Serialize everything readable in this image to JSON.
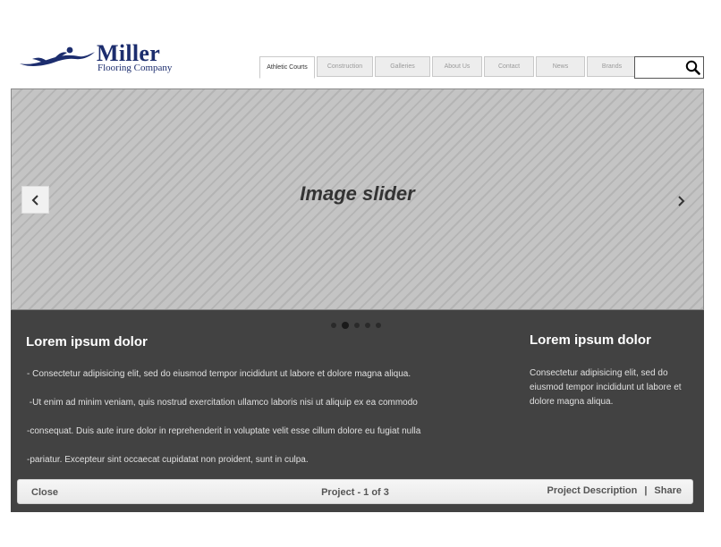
{
  "brand": {
    "name": "Miller",
    "subtitle": "Flooring Company",
    "color": "#1c2d6e"
  },
  "nav": {
    "tabs": [
      {
        "label": "Athletic Courts",
        "active": true
      },
      {
        "label": "Construction",
        "active": false
      },
      {
        "label": "Galleries",
        "active": false
      },
      {
        "label": "About Us",
        "active": false
      },
      {
        "label": "Contact",
        "active": false
      },
      {
        "label": "News",
        "active": false
      },
      {
        "label": "Brands",
        "active": false
      }
    ]
  },
  "search": {
    "icon": "search-icon",
    "placeholder": ""
  },
  "slider": {
    "title": "Image slider",
    "prev_icon": "chevron-left-icon",
    "next_icon": "chevron-right-icon",
    "total_slides": 5,
    "active_slide": 2
  },
  "details": {
    "left_heading": "Lorem ipsum dolor",
    "paragraphs": [
      "- Consectetur adipisicing elit, sed do eiusmod tempor incididunt ut labore et dolore magna aliqua.",
      " -Ut enim ad minim veniam, quis nostrud exercitation ullamco laboris nisi ut aliquip ex ea commodo",
      "-consequat. Duis aute irure dolor in reprehenderit in voluptate velit esse cillum dolore eu fugiat nulla",
      "-pariatur. Excepteur sint occaecat cupidatat non proident, sunt in culpa."
    ],
    "right_heading": "Lorem ipsum dolor",
    "right_text": "Consectetur adipisicing elit, sed do eiusmod tempor incididunt ut labore et dolore magna aliqua."
  },
  "footer": {
    "close_label": "Close",
    "counter": "Project - 1 of 3",
    "description_label": "Project Description",
    "separator": "|",
    "share_label": "Share"
  },
  "colors": {
    "panel_bg": "#424242",
    "slider_bg": "#c4c4c4"
  }
}
